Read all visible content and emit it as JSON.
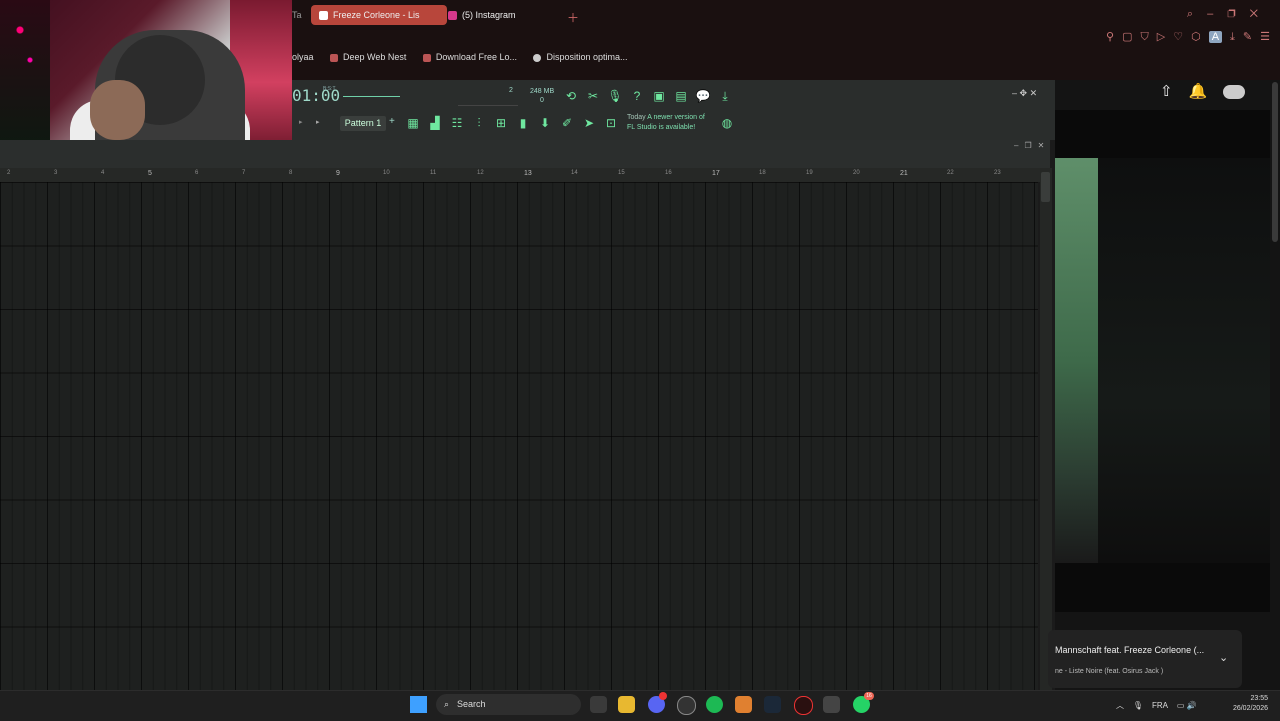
{
  "browser": {
    "tabs": [
      {
        "label": "Freeze Corleone - Lis",
        "active": true,
        "color": "#b8463b"
      },
      {
        "label": "(5) Instagram",
        "active": false
      }
    ],
    "partial_tab": "Ta",
    "bookmarks": [
      "Deep Web Nest",
      "Download Free Lo...",
      "Disposition optima..."
    ],
    "partial_bookmark": "olyaa"
  },
  "fl": {
    "time": "01:00",
    "time_label": "B:S:T",
    "mem_value": "248 MB",
    "mem_sub": "0",
    "cpu_label": "2",
    "pattern_label": "Pattern 1",
    "news_when": "Today",
    "news_text1": "A newer version of",
    "news_text2": "FL Studio is available!",
    "ruler": [
      "2",
      "3",
      "4",
      "5",
      "6",
      "7",
      "8",
      "9",
      "10",
      "11",
      "12",
      "13",
      "14",
      "15",
      "16",
      "17",
      "18",
      "19",
      "20",
      "21",
      "22",
      "23"
    ]
  },
  "side": {
    "toast_title": "Mannschaft feat. Freeze Corleone (...",
    "toast_sub": "ne - Liste Noire (feat. Osirus Jack )"
  },
  "taskbar": {
    "search_placeholder": "Search",
    "language": "FRA",
    "time": "23:55",
    "date": "26/02/2026",
    "whatsapp_badge": "16"
  },
  "colors": {
    "accent": "#6fe8a0",
    "brand": "#b8463b",
    "windows_blue": "#3ea0ff"
  }
}
